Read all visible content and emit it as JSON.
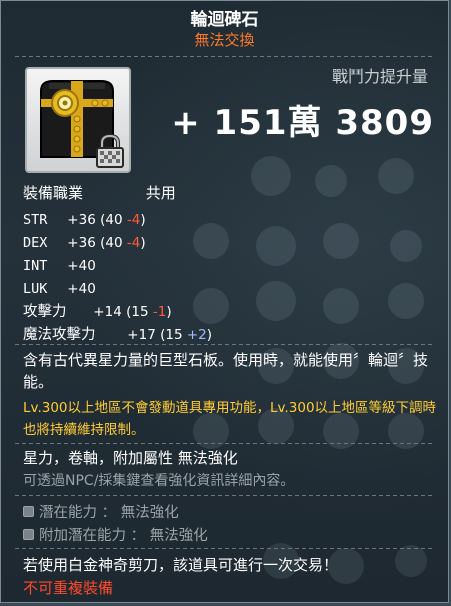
{
  "item": {
    "name": "輪迴碑石",
    "trade_status": "無法交換",
    "icon": "stone-tablet-icon",
    "lock_icon": "lock-icon"
  },
  "combat_power": {
    "label": "戰鬥力提升量",
    "value": "+ 151萬 3809"
  },
  "job": {
    "label": "裝備職業",
    "value": "共用"
  },
  "stats": [
    {
      "name": "STR",
      "value": "+36",
      "base": "(40",
      "delta": "-4",
      "close": ")"
    },
    {
      "name": "DEX",
      "value": "+36",
      "base": "(40",
      "delta": "-4",
      "close": ")"
    },
    {
      "name": "INT",
      "value": "+40"
    },
    {
      "name": "LUK",
      "value": "+40"
    }
  ],
  "attack": [
    {
      "name": "攻擊力",
      "value": "+14",
      "base": "(15",
      "delta": "-1",
      "close": ")"
    },
    {
      "name": "魔法攻擊力",
      "value": "+17",
      "base": "(15",
      "delta": "+2",
      "close": ")"
    }
  ],
  "description": "含有古代異星力量的巨型石板。使用時，就能使用〞輪迴〞技能。",
  "warning": "Lv.300以上地區不會發動道具專用功能，Lv.300以上地區等級下調時也將持續維持限制。",
  "features": "星力，卷軸，附加屬性 無法強化",
  "hint": "可透過NPC/採集鍵查看強化資訊詳細內容。",
  "potential": "潛在能力 ： 無法強化",
  "bonus_potential": "附加潛在能力 ： 無法強化",
  "scissors": "若使用白金神奇剪刀，該道具可進行一次交易！",
  "no_reequip": "不可重複裝備",
  "colors": {
    "warning": "#ffcc33",
    "negative": "#ff5a3a",
    "positive": "#a8b8ff",
    "trade": "#ff7a2a"
  }
}
